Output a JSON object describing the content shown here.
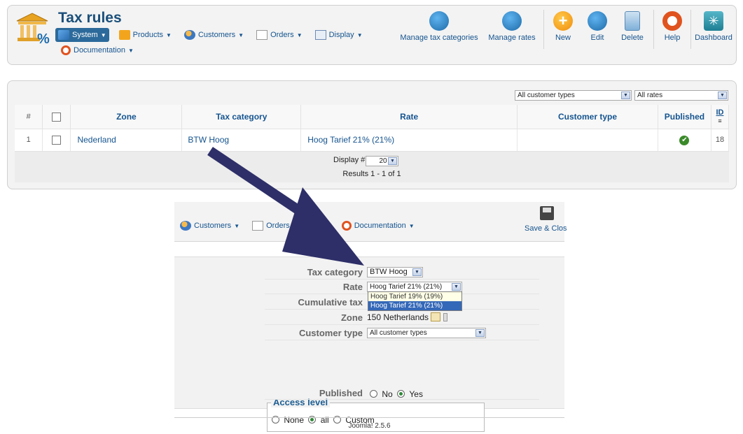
{
  "header": {
    "title": "Tax rules",
    "menu": [
      {
        "label": "System",
        "icon": "system-icon",
        "active": true
      },
      {
        "label": "Products",
        "icon": "products-icon"
      },
      {
        "label": "Customers",
        "icon": "customers-icon"
      },
      {
        "label": "Orders",
        "icon": "orders-icon"
      },
      {
        "label": "Display",
        "icon": "display-icon"
      }
    ],
    "menu2": [
      {
        "label": "Documentation",
        "icon": "lifebuoy-icon"
      }
    ],
    "toolbar": {
      "manage_tax_categories": "Manage tax categories",
      "manage_rates": "Manage rates",
      "new": "New",
      "edit": "Edit",
      "delete": "Delete",
      "help": "Help",
      "dashboard": "Dashboard"
    },
    "colors": {
      "accent": "#1a4f7a",
      "link": "#15548f",
      "active_menu": "#2c6a9b"
    }
  },
  "filters": {
    "customer_type": "All customer types",
    "rates": "All rates"
  },
  "table": {
    "columns": {
      "num": "#",
      "zone": "Zone",
      "tax_category": "Tax category",
      "rate": "Rate",
      "customer_type": "Customer type",
      "published": "Published",
      "id": "ID"
    },
    "rows": [
      {
        "num": "1",
        "zone": "Nederland",
        "tax_category": "BTW Hoog",
        "rate": "Hoog Tarief 21% (21%)",
        "customer_type": "",
        "published": true,
        "id": "18"
      }
    ],
    "display_label": "Display #",
    "display_value": "20",
    "results": "Results 1 - 1 of 1"
  },
  "editor": {
    "menu": [
      {
        "label": "Customers",
        "icon": "customers-icon"
      },
      {
        "label": "Orders",
        "icon": "orders-icon"
      },
      {
        "label": "Documentation",
        "icon": "lifebuoy-icon"
      }
    ],
    "save_close": "Save & Close",
    "fields": {
      "tax_category_label": "Tax category",
      "tax_category_value": "BTW Hoog",
      "rate_label": "Rate",
      "rate_value": "Hoog Tarief 21% (21%)",
      "rate_options": [
        "Hoog Tarief 19% (19%)",
        "Hoog Tarief 21% (21%)"
      ],
      "cumulative_label": "Cumulative tax",
      "zone_label": "Zone",
      "zone_value": "150 Netherlands",
      "customer_type_label": "Customer type",
      "customer_type_value": "All customer types",
      "access_level_legend": "Access level",
      "access_none": "None",
      "access_all": "all",
      "access_custom": "Custom",
      "published_label": "Published",
      "published_no": "No",
      "published_yes": "Yes"
    },
    "footer": "Joomla! 2.5.6"
  }
}
